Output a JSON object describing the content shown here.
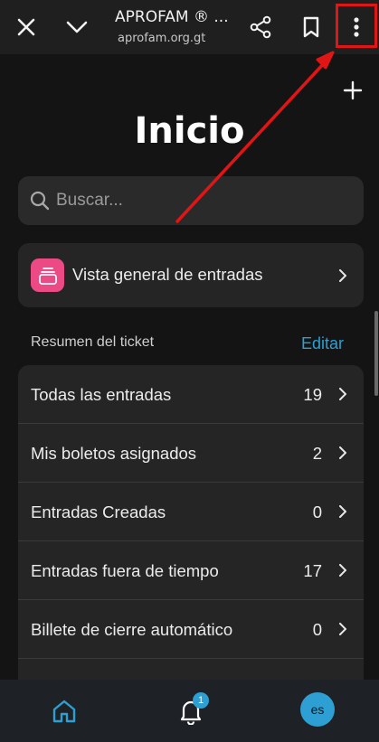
{
  "browser": {
    "title": "APROFAM ® ...",
    "url": "aprofam.org.gt",
    "icons": [
      "close-icon",
      "chevron-down-icon",
      "share-icon",
      "bookmark-icon",
      "more-vert-icon"
    ]
  },
  "page": {
    "title": "Inicio",
    "search": {
      "placeholder": "Buscar..."
    },
    "overview": {
      "label": "Vista general de entradas",
      "icon_color": "#ec4a85"
    },
    "section": {
      "label": "Resumen del ticket",
      "edit_label": "Editar"
    },
    "rows": [
      {
        "label": "Todas las entradas",
        "count": "19"
      },
      {
        "label": "Mis boletos asignados",
        "count": "2"
      },
      {
        "label": "Entradas Creadas",
        "count": "0"
      },
      {
        "label": "Entradas fuera de tiempo",
        "count": "17"
      },
      {
        "label": "Billete de cierre automático",
        "count": "0"
      }
    ]
  },
  "bottom_nav": {
    "notification_count": "1",
    "avatar_label": "es",
    "accent_color": "#2d9fd2"
  },
  "annotation": {
    "color": "#e01515"
  }
}
